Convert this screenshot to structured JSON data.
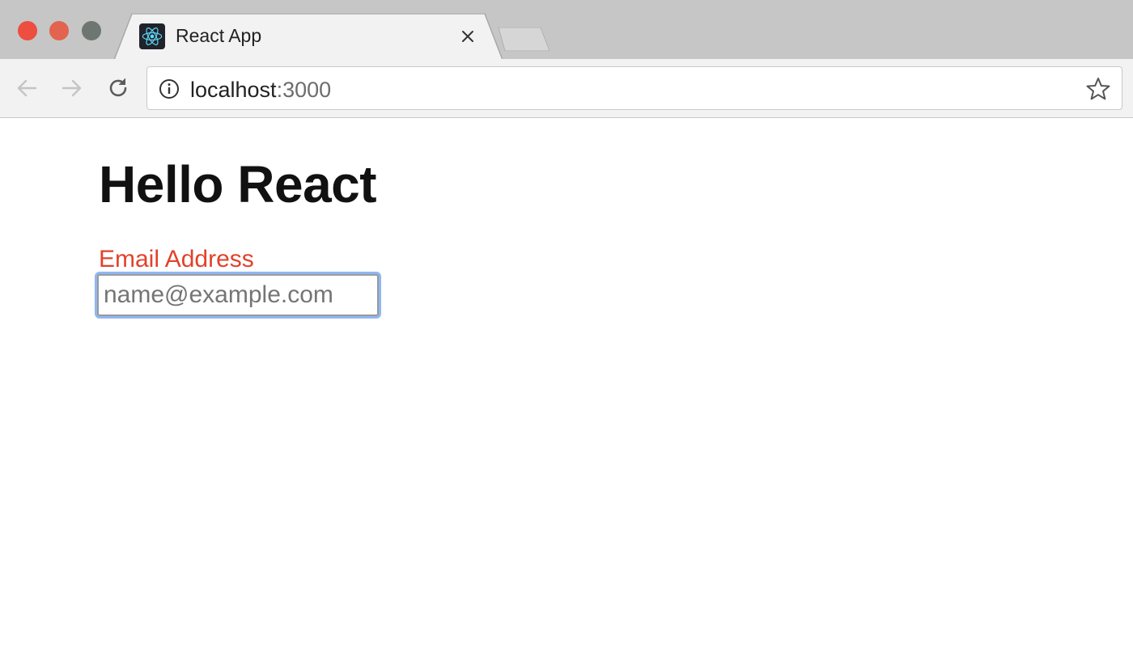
{
  "browser": {
    "tab": {
      "title": "React App",
      "favicon": "react-logo-icon"
    },
    "address_bar": {
      "host": "localhost",
      "port": ":3000"
    },
    "colors": {
      "close": "#ec4e3f",
      "minimize": "#e2634f",
      "maximize": "#6e7672",
      "tab_strip": "#c6c6c6",
      "toolbar": "#f2f2f2"
    }
  },
  "page": {
    "heading": "Hello React",
    "form": {
      "email_label": "Email Address",
      "email_placeholder": "name@example.com",
      "email_value": ""
    },
    "colors": {
      "label": "#e2422b",
      "focus_ring": "#8fb8f3"
    }
  }
}
